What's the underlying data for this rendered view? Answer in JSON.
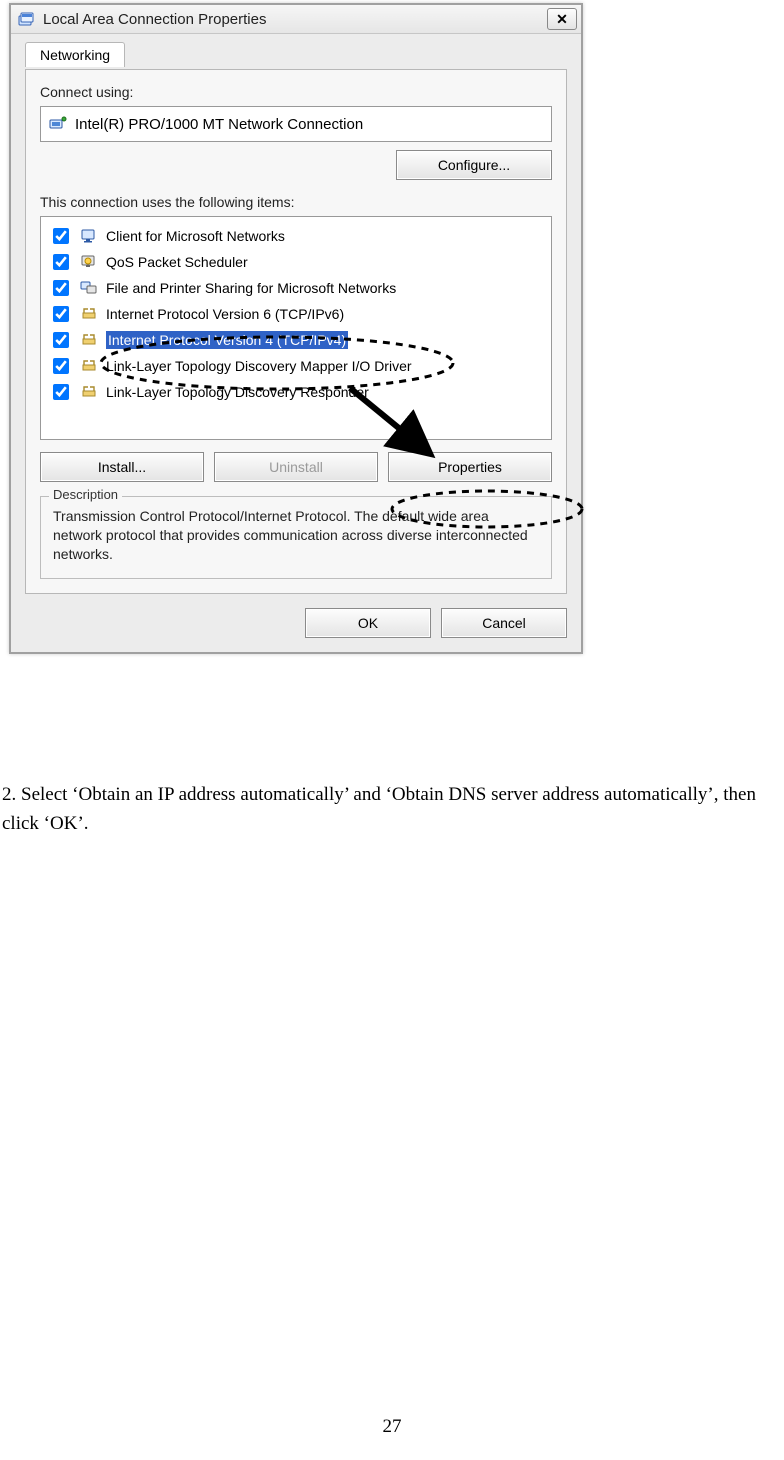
{
  "window": {
    "title": "Local Area Connection Properties",
    "close_symbol": "✕"
  },
  "tab": {
    "networking": "Networking"
  },
  "connect_using_label": "Connect using:",
  "adapter_name": "Intel(R) PRO/1000 MT Network Connection",
  "configure_button": "Configure...",
  "items_label": "This connection uses the following items:",
  "items": [
    {
      "label": "Client for Microsoft Networks",
      "checked": true,
      "icon": "client"
    },
    {
      "label": "QoS Packet Scheduler",
      "checked": true,
      "icon": "qos"
    },
    {
      "label": "File and Printer Sharing for Microsoft Networks",
      "checked": true,
      "icon": "fps"
    },
    {
      "label": "Internet Protocol Version 6 (TCP/IPv6)",
      "checked": true,
      "icon": "proto"
    },
    {
      "label": "Internet Protocol Version 4 (TCP/IPv4)",
      "checked": true,
      "icon": "proto",
      "selected": true
    },
    {
      "label": "Link-Layer Topology Discovery Mapper I/O Driver",
      "checked": true,
      "icon": "proto"
    },
    {
      "label": "Link-Layer Topology Discovery Responder",
      "checked": true,
      "icon": "proto"
    }
  ],
  "install_button": "Install...",
  "uninstall_button": "Uninstall",
  "properties_button": "Properties",
  "description": {
    "legend": "Description",
    "text": "Transmission Control Protocol/Internet Protocol. The default wide area network protocol that provides communication across diverse interconnected networks."
  },
  "ok_button": "OK",
  "cancel_button": "Cancel",
  "instruction_text": "2. Select ‘Obtain an IP address automatically’ and ‘Obtain DNS server address automatically’, then click ‘OK’.",
  "page_number": "27"
}
